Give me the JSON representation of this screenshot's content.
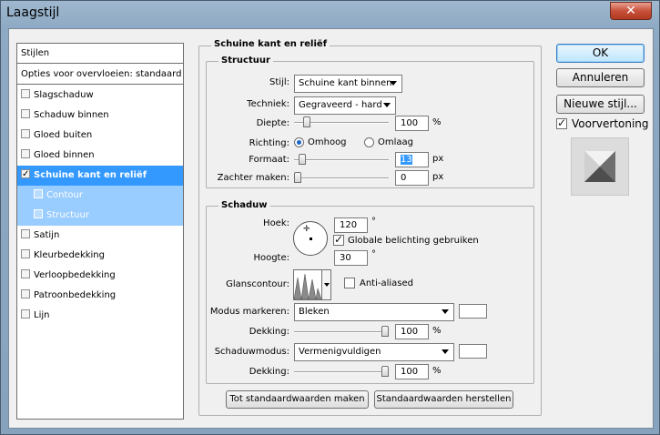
{
  "window": {
    "title": "Laagstijl",
    "close_glyph": "✕"
  },
  "styles_list": {
    "header": "Stijlen",
    "blend_options": "Opties voor overvloeien: standaard",
    "items": [
      {
        "label": "Slagschaduw",
        "checked": false,
        "selected": false,
        "sub": false
      },
      {
        "label": "Schaduw binnen",
        "checked": false,
        "selected": false,
        "sub": false
      },
      {
        "label": "Gloed buiten",
        "checked": false,
        "selected": false,
        "sub": false
      },
      {
        "label": "Gloed binnen",
        "checked": false,
        "selected": false,
        "sub": false
      },
      {
        "label": "Schuine kant en reliëf",
        "checked": true,
        "selected": true,
        "sub": false
      },
      {
        "label": "Contour",
        "checked": false,
        "selected": false,
        "sub": true
      },
      {
        "label": "Structuur",
        "checked": false,
        "selected": false,
        "sub": true
      },
      {
        "label": "Satijn",
        "checked": false,
        "selected": false,
        "sub": false
      },
      {
        "label": "Kleurbedekking",
        "checked": false,
        "selected": false,
        "sub": false
      },
      {
        "label": "Verloopbedekking",
        "checked": false,
        "selected": false,
        "sub": false
      },
      {
        "label": "Patroonbedekking",
        "checked": false,
        "selected": false,
        "sub": false
      },
      {
        "label": "Lijn",
        "checked": false,
        "selected": false,
        "sub": false
      }
    ]
  },
  "bevel": {
    "title": "Schuine kant en reliëf",
    "structure": {
      "title": "Structuur",
      "style_label": "Stijl:",
      "style_value": "Schuine kant binnen",
      "technique_label": "Techniek:",
      "technique_value": "Gegraveerd - hard",
      "depth_label": "Diepte:",
      "depth_value": "100",
      "depth_unit": "%",
      "depth_level": 0.1,
      "direction_label": "Richting:",
      "direction_up": "Omhoog",
      "direction_down": "Omlaag",
      "size_label": "Formaat:",
      "size_value": "13",
      "size_unit": "px",
      "size_level": 0.05,
      "soften_label": "Zachter maken:",
      "soften_value": "0",
      "soften_unit": "px",
      "soften_level": 0.0
    },
    "shading": {
      "title": "Schaduw",
      "angle_label": "Hoek:",
      "angle_value": "120",
      "angle_unit": "°",
      "global_light_label": "Globale belichting gebruiken",
      "global_light_checked": true,
      "altitude_label": "Hoogte:",
      "altitude_value": "30",
      "altitude_unit": "°",
      "gloss_label": "Glanscontour:",
      "anti_alias_label": "Anti-aliased",
      "anti_alias_checked": false,
      "highlight_mode_label": "Modus markeren:",
      "highlight_mode_value": "Bleken",
      "highlight_opacity_label": "Dekking:",
      "highlight_opacity_value": "100",
      "highlight_opacity_unit": "%",
      "highlight_opacity_level": 1.0,
      "shadow_mode_label": "Schaduwmodus:",
      "shadow_mode_value": "Vermenigvuldigen",
      "shadow_opacity_label": "Dekking:",
      "shadow_opacity_value": "100",
      "shadow_opacity_unit": "%",
      "shadow_opacity_level": 1.0,
      "highlight_color": "#ffffff",
      "shadow_color": "#ffffff"
    },
    "make_default": "Tot standaardwaarden maken",
    "reset_default": "Standaardwaarden herstellen"
  },
  "actions": {
    "ok": "OK",
    "cancel": "Annuleren",
    "new_style": "Nieuwe stijl...",
    "preview_label": "Voorvertoning",
    "preview_checked": true
  }
}
